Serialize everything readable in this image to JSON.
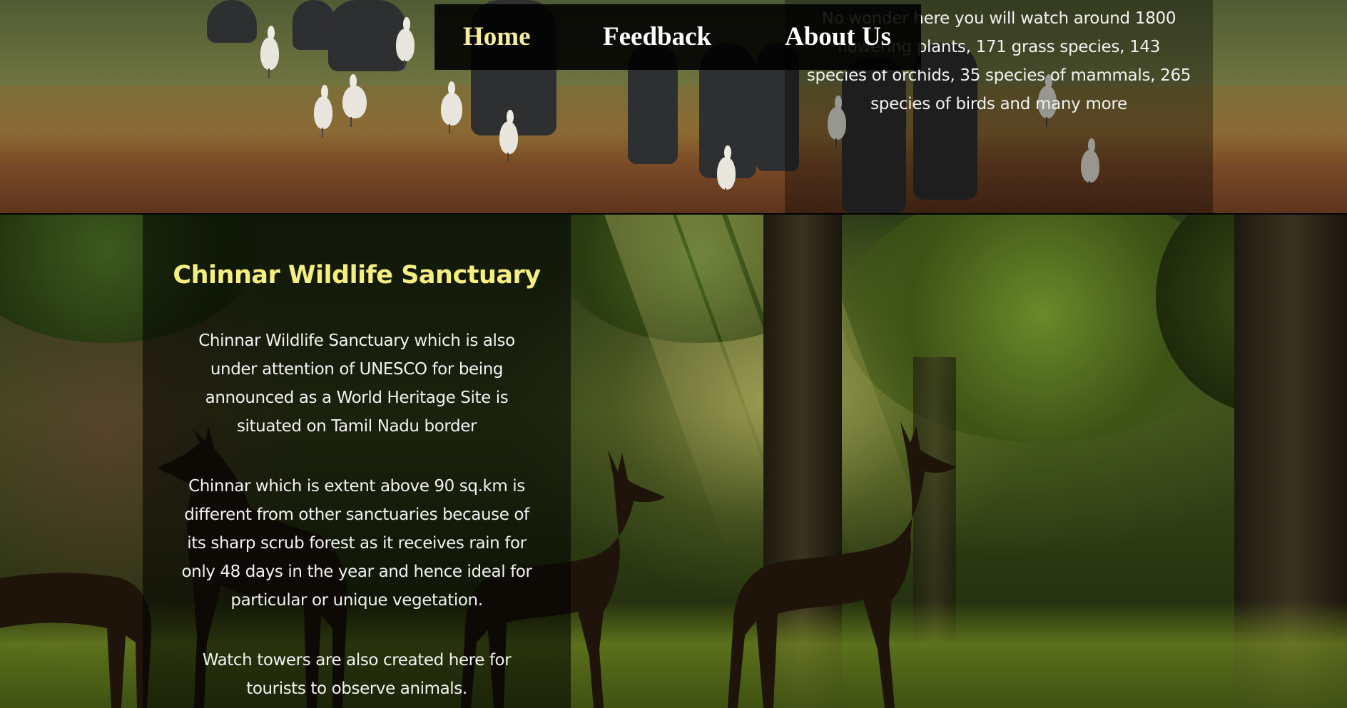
{
  "nav": {
    "items": [
      {
        "label": "Home"
      },
      {
        "label": "Feedback"
      },
      {
        "label": "About Us"
      }
    ]
  },
  "top_section": {
    "text": "No wonder here you will watch around 1800 flowering plants, 171 grass species, 143 species of orchids, 35 species of mammals, 265 species of birds and many more"
  },
  "main_section": {
    "title": "Chinnar Wildlife Sanctuary",
    "paragraphs": [
      "Chinnar Wildlife Sanctuary which is also under attention of UNESCO for being announced as a World Heritage Site is situated on Tamil Nadu border",
      "Chinnar which is extent above 90 sq.km is different from other sanctuaries because of its sharp scrub forest as it receives rain for only 48 days in the year and hence ideal for particular or unique vegetation.",
      "Watch towers are also created here for tourists to observe animals."
    ]
  },
  "colors": {
    "title_accent": "#f5ef80",
    "nav_active": "#f7ee9a",
    "nav_text": "#ffffff",
    "body_text": "#f2f2f2"
  }
}
